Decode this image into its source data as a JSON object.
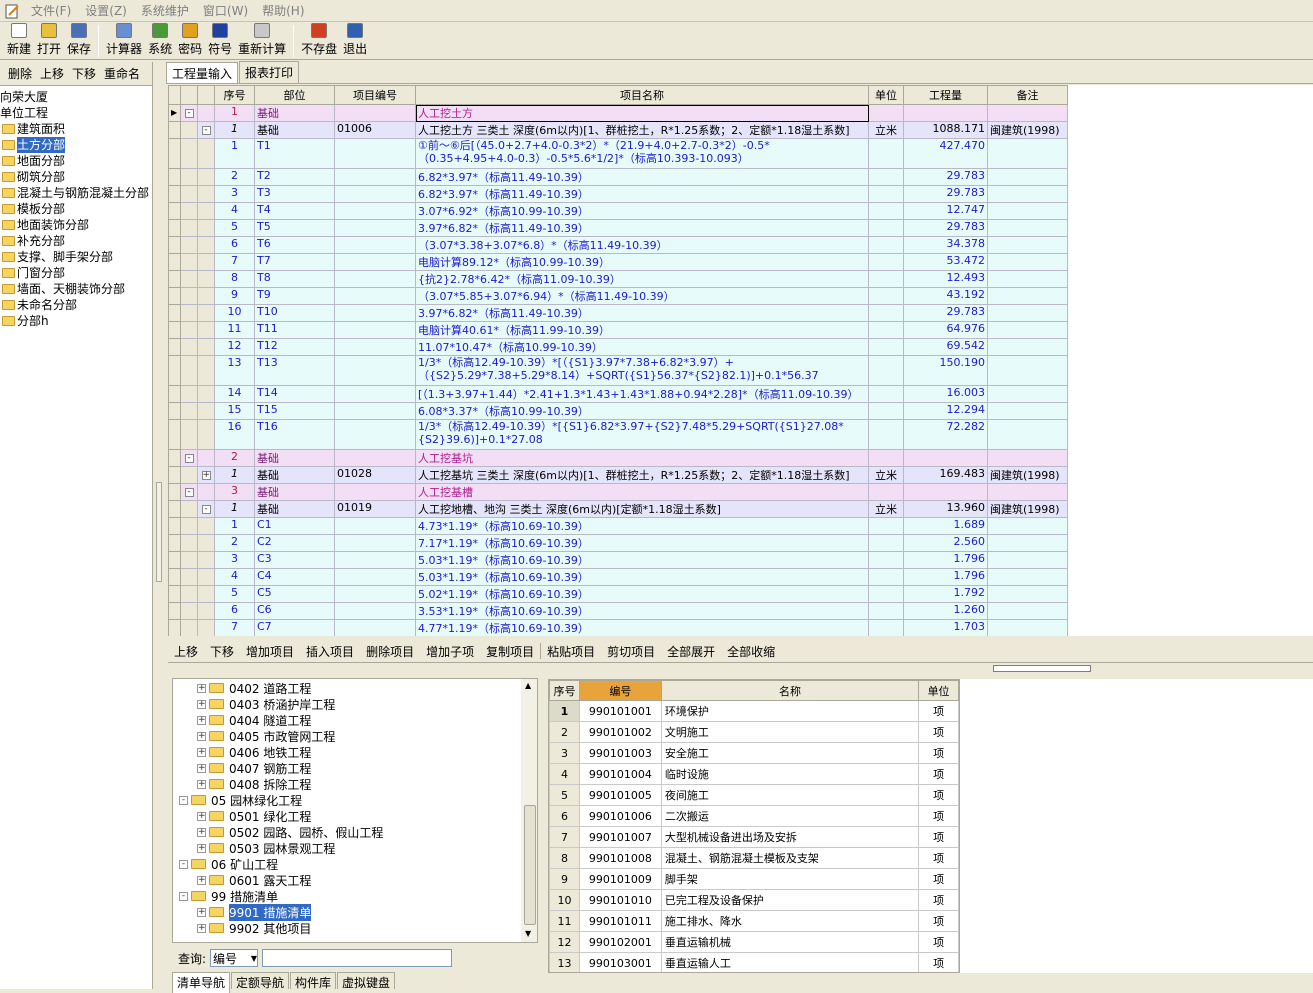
{
  "menu": [
    "文件(F)",
    "设置(Z)",
    "系统维护",
    "窗口(W)",
    "帮助(H)"
  ],
  "toolbar": [
    {
      "label": "新建",
      "icon": "new-icon",
      "color": "#ffffff"
    },
    {
      "label": "打开",
      "icon": "open-icon",
      "color": "#e8c040"
    },
    {
      "label": "保存",
      "icon": "save-icon",
      "color": "#4a6fb5"
    },
    {
      "label": "计算器",
      "icon": "calculator-icon",
      "color": "#6a8fd0"
    },
    {
      "label": "系统",
      "icon": "system-icon",
      "color": "#4a9a3a"
    },
    {
      "label": "密码",
      "icon": "password-icon",
      "color": "#e0a020"
    },
    {
      "label": "符号",
      "icon": "symbol-icon",
      "color": "#2040a0"
    },
    {
      "label": "重新计算",
      "icon": "recalc-icon",
      "color": "#c8c8c8"
    },
    {
      "label": "不存盘",
      "icon": "nosave-icon",
      "color": "#d04020"
    },
    {
      "label": "退出",
      "icon": "exit-icon",
      "color": "#3060b0"
    }
  ],
  "left_tools": [
    "删除",
    "上移",
    "下移",
    "重命名"
  ],
  "left_tree": {
    "root": "向荣大厦",
    "unit": "单位工程",
    "items": [
      "建筑面积",
      "土方分部",
      "地面分部",
      "砌筑分部",
      "混凝土与钢筋混凝土分部",
      "模板分部",
      "地面装饰分部",
      "补充分部",
      "支撑、脚手架分部",
      "门窗分部",
      "墙面、天棚装饰分部",
      "未命名分部",
      "分部h"
    ],
    "selected": "土方分部"
  },
  "tabs": [
    "工程量输入",
    "报表打印"
  ],
  "grid": {
    "headers": [
      "序号",
      "部位",
      "项目编号",
      "项目名称",
      "单位",
      "工程量",
      "备注"
    ],
    "rows": [
      {
        "level": 1,
        "exp": "-",
        "seq": "1",
        "part": "基础",
        "code": "",
        "name": "人工挖土方",
        "unit": "",
        "qty": "",
        "note": "",
        "current": true
      },
      {
        "level": 2,
        "exp": "-",
        "seq": "1",
        "part": "基础",
        "code": "01006",
        "name": "人工挖土方 三类土 深度(6m以内)[1、群桩挖土，R*1.25系数；2、定额*1.18湿土系数]",
        "unit": "立米",
        "qty": "1088.171",
        "note": "闽建筑(1998)"
      },
      {
        "level": 3,
        "seq": "1",
        "part": "T1",
        "name": "①前～⑥后[（45.0+2.7+4.0-0.3*2）*（21.9+4.0+2.7-0.3*2）-0.5*（0.35+4.95+4.0-0.3）-0.5*5.6*1/2]*（标高10.393-10.093）",
        "qty": "427.470",
        "tall": true
      },
      {
        "level": 3,
        "seq": "2",
        "part": "T2",
        "name": "6.82*3.97*（标高11.49-10.39）",
        "qty": "29.783"
      },
      {
        "level": 3,
        "seq": "3",
        "part": "T3",
        "name": "6.82*3.97*（标高11.49-10.39）",
        "qty": "29.783"
      },
      {
        "level": 3,
        "seq": "4",
        "part": "T4",
        "name": "3.07*6.92*（标高10.99-10.39）",
        "qty": "12.747"
      },
      {
        "level": 3,
        "seq": "5",
        "part": "T5",
        "name": "3.97*6.82*（标高11.49-10.39）",
        "qty": "29.783"
      },
      {
        "level": 3,
        "seq": "6",
        "part": "T6",
        "name": "（3.07*3.38+3.07*6.8）*（标高11.49-10.39）",
        "qty": "34.378"
      },
      {
        "level": 3,
        "seq": "7",
        "part": "T7",
        "name": "电脑计算89.12*（标高10.99-10.39）",
        "qty": "53.472"
      },
      {
        "level": 3,
        "seq": "8",
        "part": "T8",
        "name": "{抗2}2.78*6.42*（标高11.09-10.39）",
        "qty": "12.493"
      },
      {
        "level": 3,
        "seq": "9",
        "part": "T9",
        "name": "（3.07*5.85+3.07*6.94）*（标高11.49-10.39）",
        "qty": "43.192"
      },
      {
        "level": 3,
        "seq": "10",
        "part": "T10",
        "name": "3.97*6.82*（标高11.49-10.39）",
        "qty": "29.783"
      },
      {
        "level": 3,
        "seq": "11",
        "part": "T11",
        "name": "电脑计算40.61*（标高11.99-10.39）",
        "qty": "64.976"
      },
      {
        "level": 3,
        "seq": "12",
        "part": "T12",
        "name": "11.07*10.47*（标高10.99-10.39）",
        "qty": "69.542"
      },
      {
        "level": 3,
        "seq": "13",
        "part": "T13",
        "name": "1/3*（标高12.49-10.39）*[（{S1}3.97*7.38+6.82*3.97）+（{S2}5.29*7.38+5.29*8.14）+SQRT({S1}56.37*{S2}82.1)]+0.1*56.37",
        "qty": "150.190",
        "tall": true
      },
      {
        "level": 3,
        "seq": "14",
        "part": "T14",
        "name": "[（1.3+3.97+1.44）*2.41+1.3*1.43+1.43*1.88+0.94*2.28]*（标高11.09-10.39）",
        "qty": "16.003"
      },
      {
        "level": 3,
        "seq": "15",
        "part": "T15",
        "name": "6.08*3.37*（标高10.99-10.39）",
        "qty": "12.294"
      },
      {
        "level": 3,
        "seq": "16",
        "part": "T16",
        "name": "1/3*（标高12.49-10.39）*[{S1}6.82*3.97+{S2}7.48*5.29+SQRT({S1}27.08*{S2}39.6)]+0.1*27.08",
        "qty": "72.282",
        "tall": true
      },
      {
        "level": 1,
        "exp": "-",
        "seq": "2",
        "part": "基础",
        "code": "",
        "name": "人工挖基坑",
        "unit": "",
        "qty": "",
        "note": ""
      },
      {
        "level": 2,
        "exp": "+",
        "seq": "1",
        "part": "基础",
        "code": "01028",
        "name": "人工挖基坑 三类土 深度(6m以内)[1、群桩挖土，R*1.25系数；2、定额*1.18湿土系数]",
        "unit": "立米",
        "qty": "169.483",
        "note": "闽建筑(1998)"
      },
      {
        "level": 1,
        "exp": "-",
        "seq": "3",
        "part": "基础",
        "code": "",
        "name": "人工挖基槽",
        "unit": "",
        "qty": "",
        "note": ""
      },
      {
        "level": 2,
        "exp": "-",
        "seq": "1",
        "part": "基础",
        "code": "01019",
        "name": "人工挖地槽、地沟 三类土 深度(6m以内)[定额*1.18湿土系数]",
        "unit": "立米",
        "qty": "13.960",
        "note": "闽建筑(1998)"
      },
      {
        "level": 3,
        "seq": "1",
        "part": "C1",
        "name": "4.73*1.19*（标高10.69-10.39）",
        "qty": "1.689"
      },
      {
        "level": 3,
        "seq": "2",
        "part": "C2",
        "name": "7.17*1.19*（标高10.69-10.39）",
        "qty": "2.560"
      },
      {
        "level": 3,
        "seq": "3",
        "part": "C3",
        "name": "5.03*1.19*（标高10.69-10.39）",
        "qty": "1.796"
      },
      {
        "level": 3,
        "seq": "4",
        "part": "C4",
        "name": "5.03*1.19*（标高10.69-10.39）",
        "qty": "1.796"
      },
      {
        "level": 3,
        "seq": "5",
        "part": "C5",
        "name": "5.02*1.19*（标高10.69-10.39）",
        "qty": "1.792"
      },
      {
        "level": 3,
        "seq": "6",
        "part": "C6",
        "name": "3.53*1.19*（标高10.69-10.39）",
        "qty": "1.260"
      },
      {
        "level": 3,
        "seq": "7",
        "part": "C7",
        "name": "4.77*1.19*（标高10.69-10.39）",
        "qty": "1.703"
      }
    ]
  },
  "bottom_tools": [
    "上移",
    "下移",
    "增加项目",
    "插入项目",
    "删除项目",
    "增加子项",
    "复制项目",
    "粘贴项目",
    "剪切项目",
    "全部展开",
    "全部收缩"
  ],
  "lib_tree": [
    {
      "indent": 1,
      "pm": "+",
      "code": "0402",
      "label": "道路工程"
    },
    {
      "indent": 1,
      "pm": "+",
      "code": "0403",
      "label": "桥涵护岸工程"
    },
    {
      "indent": 1,
      "pm": "+",
      "code": "0404",
      "label": "隧道工程"
    },
    {
      "indent": 1,
      "pm": "+",
      "code": "0405",
      "label": "市政管网工程"
    },
    {
      "indent": 1,
      "pm": "+",
      "code": "0406",
      "label": "地铁工程"
    },
    {
      "indent": 1,
      "pm": "+",
      "code": "0407",
      "label": "钢筋工程"
    },
    {
      "indent": 1,
      "pm": "+",
      "code": "0408",
      "label": "拆除工程"
    },
    {
      "indent": 0,
      "pm": "-",
      "code": "05",
      "label": "园林绿化工程"
    },
    {
      "indent": 1,
      "pm": "+",
      "code": "0501",
      "label": "绿化工程"
    },
    {
      "indent": 1,
      "pm": "+",
      "code": "0502",
      "label": "园路、园桥、假山工程"
    },
    {
      "indent": 1,
      "pm": "+",
      "code": "0503",
      "label": "园林景观工程"
    },
    {
      "indent": 0,
      "pm": "-",
      "code": "06",
      "label": "矿山工程"
    },
    {
      "indent": 1,
      "pm": "+",
      "code": "0601",
      "label": "露天工程"
    },
    {
      "indent": 0,
      "pm": "-",
      "code": "99",
      "label": "措施清单"
    },
    {
      "indent": 1,
      "pm": "+",
      "code": "9901",
      "label": "措施清单",
      "selected": true
    },
    {
      "indent": 1,
      "pm": "+",
      "code": "9902",
      "label": "其他项目"
    }
  ],
  "query": {
    "label": "查询:",
    "option": "编号",
    "value": ""
  },
  "bottom_tabs": [
    "清单导航",
    "定额导航",
    "构件库",
    "虚拟键盘"
  ],
  "lib_grid": {
    "headers": [
      "序号",
      "编号",
      "名称",
      "单位"
    ],
    "rows": [
      {
        "n": "1",
        "code": "990101001",
        "name": "环境保护",
        "unit": "项"
      },
      {
        "n": "2",
        "code": "990101002",
        "name": "文明施工",
        "unit": "项"
      },
      {
        "n": "3",
        "code": "990101003",
        "name": "安全施工",
        "unit": "项"
      },
      {
        "n": "4",
        "code": "990101004",
        "name": "临时设施",
        "unit": "项"
      },
      {
        "n": "5",
        "code": "990101005",
        "name": "夜间施工",
        "unit": "项"
      },
      {
        "n": "6",
        "code": "990101006",
        "name": "二次搬运",
        "unit": "项"
      },
      {
        "n": "7",
        "code": "990101007",
        "name": "大型机械设备进出场及安拆",
        "unit": "项"
      },
      {
        "n": "8",
        "code": "990101008",
        "name": "混凝土、钢筋混凝土模板及支架",
        "unit": "项"
      },
      {
        "n": "9",
        "code": "990101009",
        "name": "脚手架",
        "unit": "项"
      },
      {
        "n": "10",
        "code": "990101010",
        "name": "已完工程及设备保护",
        "unit": "项"
      },
      {
        "n": "11",
        "code": "990101011",
        "name": "施工排水、降水",
        "unit": "项"
      },
      {
        "n": "12",
        "code": "990102001",
        "name": "垂直运输机械",
        "unit": "项"
      },
      {
        "n": "13",
        "code": "990103001",
        "name": "垂直运输人工",
        "unit": "项"
      }
    ]
  }
}
